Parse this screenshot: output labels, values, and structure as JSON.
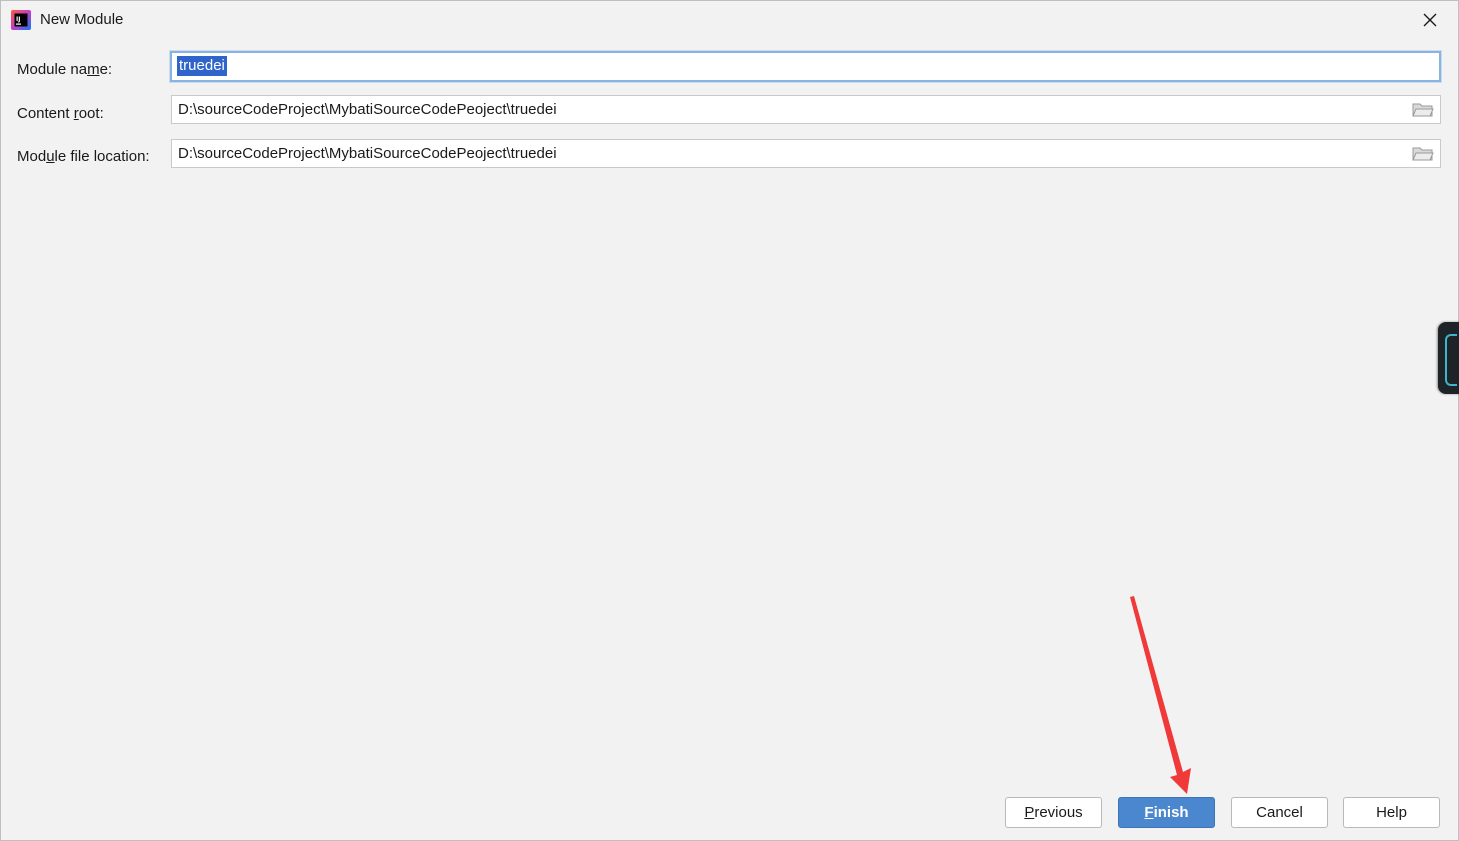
{
  "window": {
    "title": "New Module",
    "close_label": "✕"
  },
  "form": {
    "module_name": {
      "label_pre": "Module na",
      "label_mnemonic": "m",
      "label_post": "e:",
      "value": "truedei"
    },
    "content_root": {
      "label_pre": "Content ",
      "label_mnemonic": "r",
      "label_post": "oot:",
      "value": "D:\\sourceCodeProject\\MybatiSourceCodePeoject\\truedei"
    },
    "module_file_location": {
      "label_pre": "Mod",
      "label_mnemonic": "u",
      "label_post": "le file location:",
      "value": "D:\\sourceCodeProject\\MybatiSourceCodePeoject\\truedei"
    }
  },
  "buttons": {
    "previous": {
      "mnemonic": "P",
      "rest": "revious"
    },
    "finish": {
      "mnemonic": "F",
      "rest": "inish"
    },
    "cancel": {
      "label": "Cancel"
    },
    "help": {
      "label": "Help"
    }
  },
  "annotation": {
    "arrow_color": "#f03a3a"
  },
  "colors": {
    "accent": "#4a87cf",
    "selection": "#2f65ca",
    "focus_border": "#8ab4e0"
  }
}
